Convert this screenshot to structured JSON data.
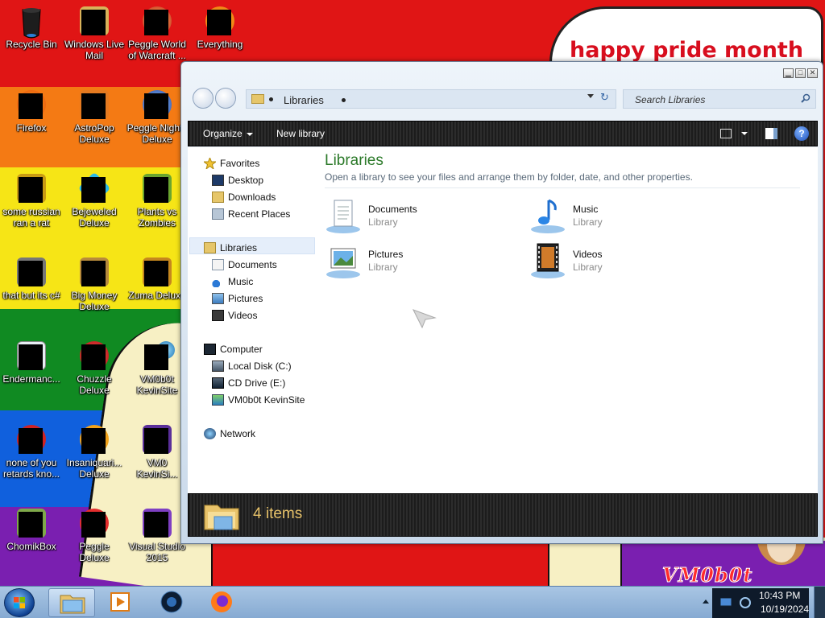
{
  "wallpaper": {
    "banner_text": "happy pride month",
    "signature_text": "VM0b0t",
    "colors": {
      "red": "#e01515",
      "orange": "#f47a14",
      "yellow": "#f6e516",
      "green": "#108a22",
      "blue": "#1060dd",
      "purple": "#7a1fb0",
      "cream": "#f7f0c4"
    }
  },
  "desktop_icons": [
    {
      "label": "Recycle Bin",
      "icon": "recycle-bin-icon"
    },
    {
      "label": "Windows Live Mail",
      "icon": "mail-icon"
    },
    {
      "label": "Peggle World of Warcraft ...",
      "icon": "peggle-icon"
    },
    {
      "label": "Everything",
      "icon": "everything-search-icon"
    },
    {
      "label": "Firefox",
      "icon": "firefox-icon"
    },
    {
      "label": "AstroPop Deluxe",
      "icon": "astropop-icon"
    },
    {
      "label": "Peggle Nights Deluxe",
      "icon": "peggle-nights-icon"
    },
    {
      "label": "some russian ran a rat",
      "icon": "game-icon"
    },
    {
      "label": "Bejeweled Deluxe",
      "icon": "bejeweled-icon"
    },
    {
      "label": "Plants vs Zombies",
      "icon": "plants-vs-zombies-icon"
    },
    {
      "label": "that but its c#",
      "icon": "shortcut-icon"
    },
    {
      "label": "Big Money Deluxe",
      "icon": "big-money-icon"
    },
    {
      "label": "Zuma Deluxe",
      "icon": "zuma-icon"
    },
    {
      "label": "Endermanc...",
      "icon": "application-icon"
    },
    {
      "label": "Chuzzle Deluxe",
      "icon": "chuzzle-icon"
    },
    {
      "label": "VM0b0t KevinSite",
      "icon": "globe-icon"
    },
    {
      "label": "none of you retards kno...",
      "icon": "game-icon"
    },
    {
      "label": "Insaniquari... Deluxe",
      "icon": "insaniquarium-icon"
    },
    {
      "label": "VM0 KevinSi...",
      "icon": "shortcut-icon"
    },
    {
      "label": "ChomikBox",
      "icon": "chomikbox-icon"
    },
    {
      "label": "Peggle Deluxe",
      "icon": "peggle-icon"
    },
    {
      "label": "Visual Studio 2015",
      "icon": "visual-studio-icon"
    }
  ],
  "explorer": {
    "window_controls": [
      "minimize",
      "maximize",
      "close"
    ],
    "address": {
      "crumb": "Libraries"
    },
    "search": {
      "placeholder": "Search Libraries"
    },
    "toolbar": {
      "organize_label": "Organize",
      "new_library_label": "New library",
      "help_glyph": "?"
    },
    "nav": {
      "favorites": {
        "label": "Favorites",
        "items": [
          "Desktop",
          "Downloads",
          "Recent Places"
        ]
      },
      "libraries": {
        "label": "Libraries",
        "items": [
          "Documents",
          "Music",
          "Pictures",
          "Videos"
        ]
      },
      "computer": {
        "label": "Computer",
        "items": [
          "Local Disk (C:)",
          "CD Drive (E:)",
          "VM0b0t KevinSite"
        ]
      },
      "network": {
        "label": "Network"
      }
    },
    "content": {
      "title": "Libraries",
      "subtitle": "Open a library to see your files and arrange them by folder, date, and other properties.",
      "libraries": [
        {
          "name": "Documents",
          "type": "Library",
          "icon": "documents-library-icon"
        },
        {
          "name": "Music",
          "type": "Library",
          "icon": "music-library-icon"
        },
        {
          "name": "Pictures",
          "type": "Library",
          "icon": "pictures-library-icon"
        },
        {
          "name": "Videos",
          "type": "Library",
          "icon": "videos-library-icon"
        }
      ]
    },
    "details": {
      "item_count": "4 items"
    }
  },
  "taskbar": {
    "pinned": [
      "explorer-icon",
      "media-player-icon",
      "media-center-icon",
      "firefox-icon"
    ],
    "clock": {
      "time": "10:43 PM",
      "date": "10/19/2024"
    }
  }
}
